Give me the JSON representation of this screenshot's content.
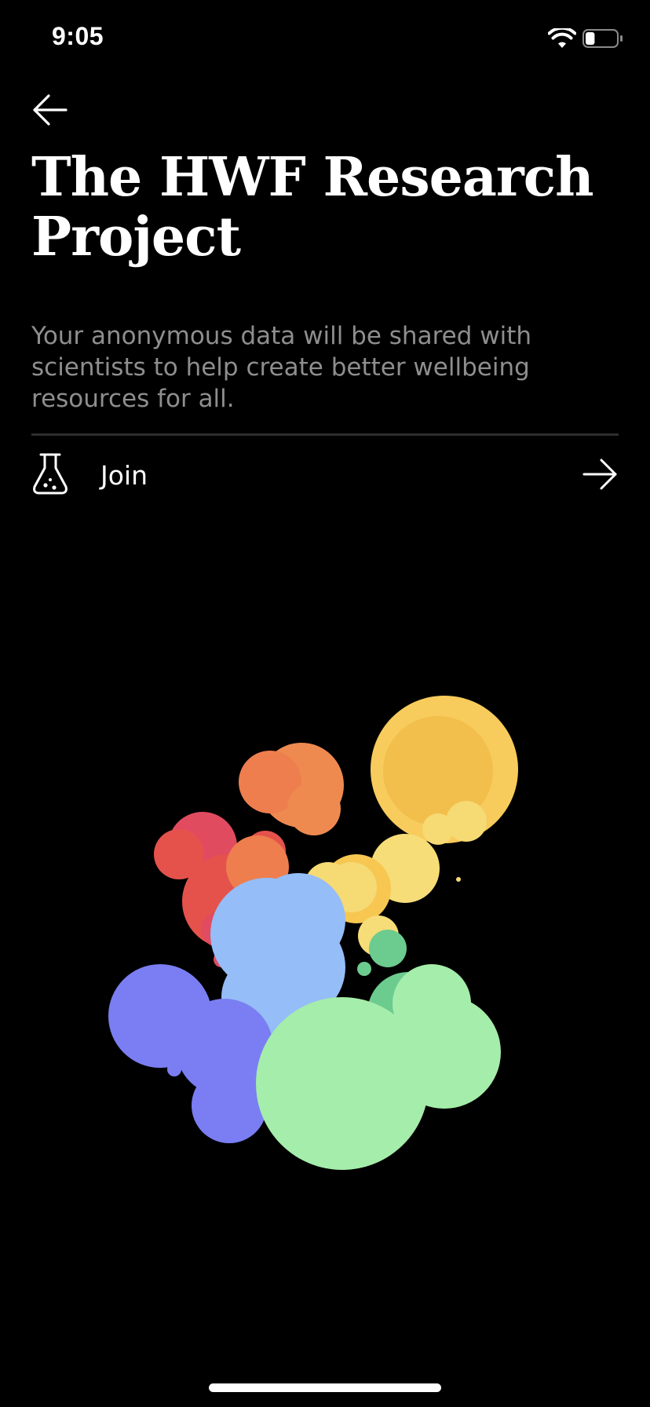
{
  "status_bar": {
    "time": "9:05",
    "wifi_icon": "wifi-icon",
    "battery_icon": "battery-icon",
    "battery_level": 0.3
  },
  "nav": {
    "back_icon": "arrow-left-icon"
  },
  "header": {
    "title": "The HWF Research Project"
  },
  "body": {
    "description": "Your anonymous data will be shared with scientists to help create better wellbeing resources for all."
  },
  "join_row": {
    "icon": "flask-icon",
    "label": "Join",
    "chevron_icon": "arrow-right-icon"
  },
  "colors": {
    "background": "#000000",
    "text_primary": "#ffffff",
    "text_secondary": "#8e8e8e",
    "divider": "#2e2e2e",
    "bubble_yellow": "#F7CB5C",
    "bubble_orange": "#EE8450",
    "bubble_red": "#E5524C",
    "bubble_light_blue": "#95BDF7",
    "bubble_purple": "#7A7EF2",
    "bubble_green": "#A5EDAA"
  }
}
